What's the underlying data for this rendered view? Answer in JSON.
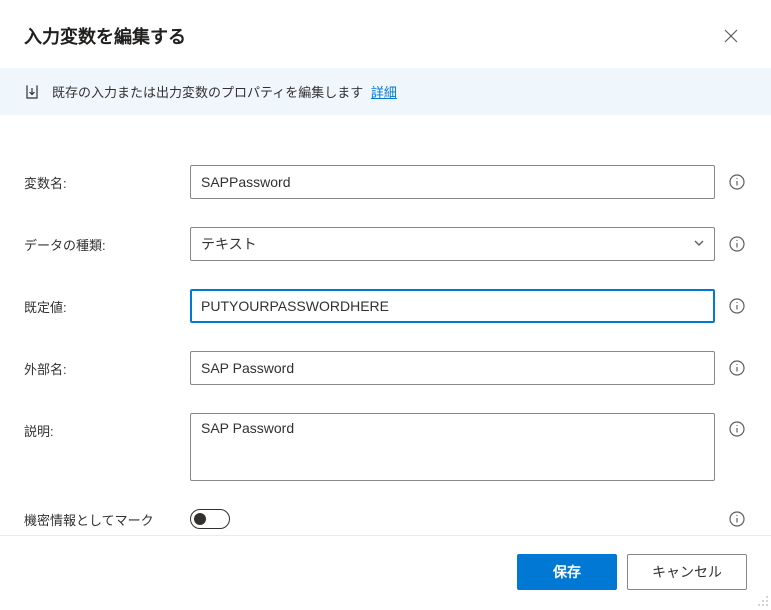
{
  "dialog": {
    "title": "入力変数を編集する"
  },
  "banner": {
    "text": "既存の入力または出力変数のプロパティを編集します",
    "link_text": "詳細"
  },
  "fields": {
    "name": {
      "label": "変数名:",
      "value": "SAPPassword"
    },
    "datatype": {
      "label": "データの種類:",
      "value": "テキスト"
    },
    "default": {
      "label": "既定値:",
      "value": "PUTYOURPASSWORDHERE"
    },
    "external": {
      "label": "外部名:",
      "value": "SAP Password"
    },
    "description": {
      "label": "説明:",
      "value": "SAP Password"
    },
    "sensitive": {
      "label": "機密情報としてマーク",
      "value": false
    }
  },
  "footer": {
    "save": "保存",
    "cancel": "キャンセル"
  }
}
